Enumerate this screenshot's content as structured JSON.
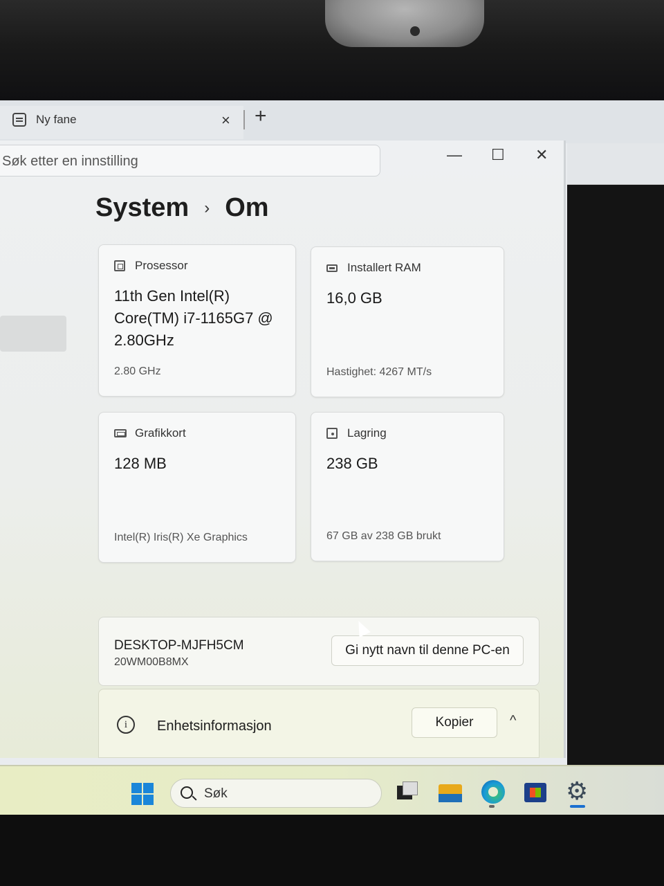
{
  "browser": {
    "tab_title": "Ny fane",
    "tab_close": "×",
    "new_tab": "+"
  },
  "settings": {
    "search_placeholder": "Søk etter en innstilling",
    "window_controls": {
      "minimize": "—",
      "maximize": "☐",
      "close": "✕"
    },
    "breadcrumb": {
      "parent": "System",
      "separator": "›",
      "current": "Om"
    },
    "cards": {
      "processor": {
        "label": "Prosessor",
        "value": "11th Gen Intel(R) Core(TM) i7-1165G7 @ 2.80GHz",
        "sub": "2.80 GHz"
      },
      "ram": {
        "label": "Installert RAM",
        "value": "16,0 GB",
        "sub": "Hastighet: 4267 MT/s"
      },
      "gpu": {
        "label": "Grafikkort",
        "value": "128 MB",
        "sub": "Intel(R) Iris(R) Xe Graphics"
      },
      "storage": {
        "label": "Lagring",
        "value": "238 GB",
        "sub": "67 GB av 238 GB brukt"
      }
    },
    "pc": {
      "name": "DESKTOP-MJFH5CM",
      "model": "20WM00B8MX",
      "rename_label": "Gi nytt navn til denne PC-en"
    },
    "device_info": {
      "icon": "i",
      "label": "Enhetsinformasjon",
      "copy_label": "Kopier",
      "chevron": "^"
    }
  },
  "taskbar": {
    "search_label": "Søk",
    "apps": [
      "start-icon",
      "task-view-icon",
      "file-explorer-icon",
      "edge-icon",
      "store-icon",
      "settings-icon"
    ]
  }
}
